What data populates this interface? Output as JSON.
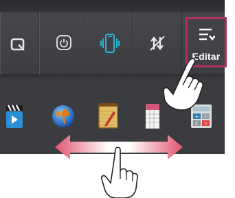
{
  "quick_settings": {
    "tiles": [
      {
        "icon": "screen-rotate-icon",
        "state": "off",
        "color": "#e8e8e8"
      },
      {
        "icon": "power-icon",
        "state": "off",
        "color": "#e8e8e8"
      },
      {
        "icon": "vibrate-icon",
        "state": "on",
        "color": "#2bb5d6"
      },
      {
        "icon": "data-sync-icon",
        "state": "off",
        "color": "#e8e8e8"
      }
    ],
    "edit_button": {
      "label": "Editar",
      "icon": "edit-list-icon",
      "highlight_color": "#b5305e"
    }
  },
  "apps": [
    {
      "icon": "video-clapper-icon"
    },
    {
      "icon": "globe-browser-icon"
    },
    {
      "icon": "notepad-icon"
    },
    {
      "icon": "calendar-icon"
    },
    {
      "icon": "calculator-icon"
    }
  ],
  "gesture": {
    "type": "swipe-horizontal",
    "arrow_colors": [
      "#e0556d",
      "#ffffff"
    ]
  }
}
